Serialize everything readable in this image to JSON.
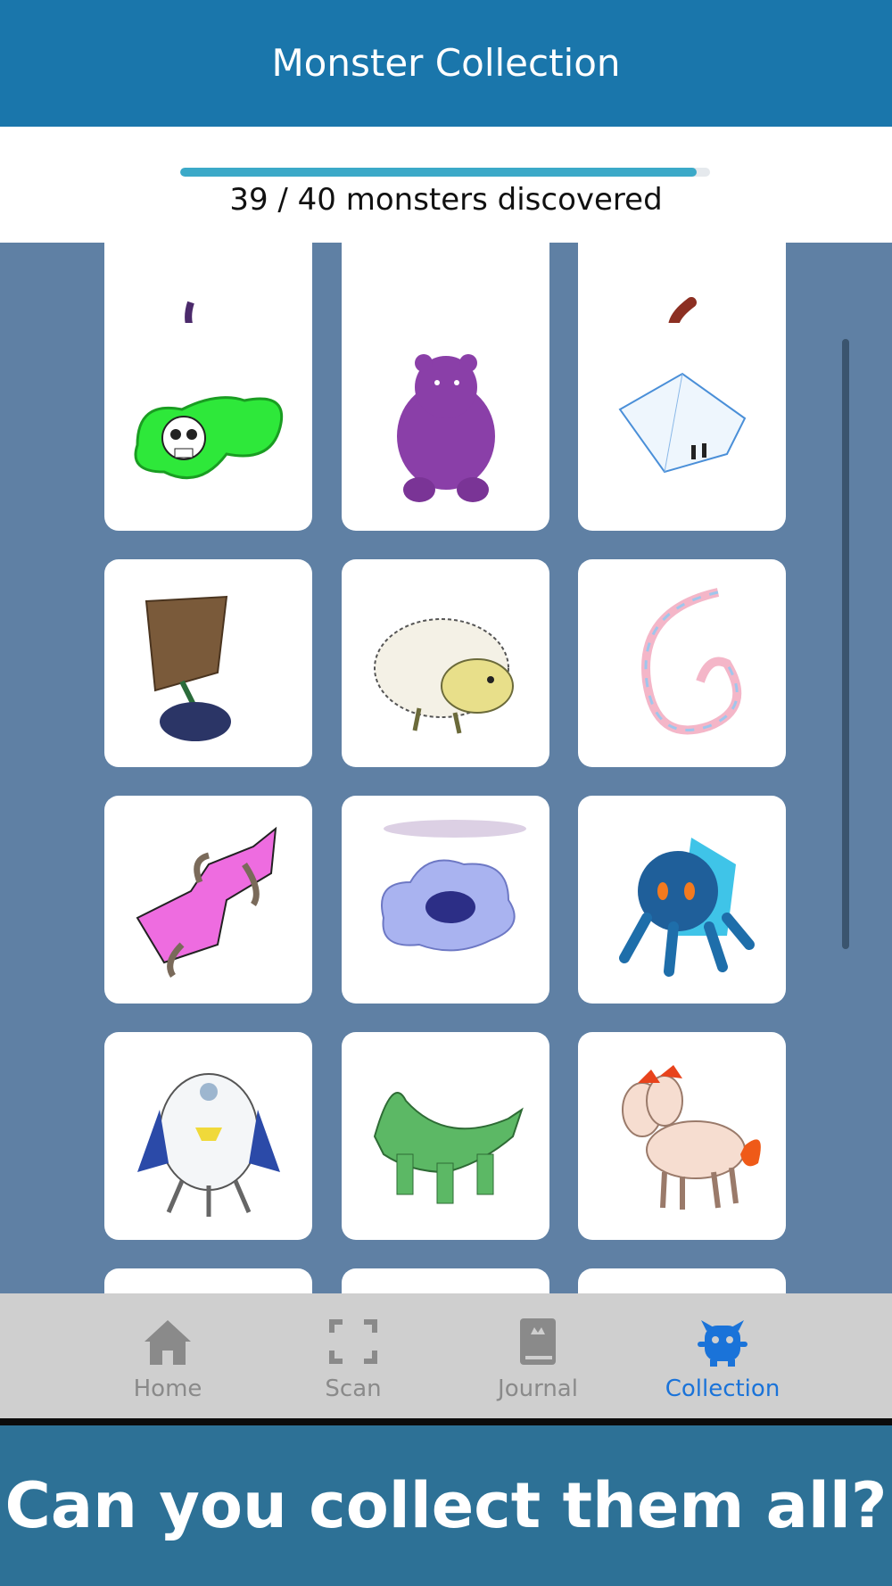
{
  "header": {
    "title": "Monster Collection"
  },
  "progress": {
    "discovered": 39,
    "total": 40,
    "label": "39 / 40 monsters discovered"
  },
  "grid": {
    "monsters": [
      "purple-tail-monster",
      "unknown-monster",
      "red-tail-monster",
      "green-skull-slime",
      "purple-bear",
      "ice-cube-creature",
      "box-shell-beetle",
      "yellow-hedgehog",
      "pastel-ribbon-snake",
      "pink-worm-creature",
      "lavender-cloud",
      "blue-crystal-spider",
      "penguin-robot",
      "green-dragon-bridge",
      "two-headed-fire-horse"
    ]
  },
  "tabs": [
    {
      "label": "Home",
      "icon": "home-icon",
      "active": false
    },
    {
      "label": "Scan",
      "icon": "scan-icon",
      "active": false
    },
    {
      "label": "Journal",
      "icon": "journal-icon",
      "active": false
    },
    {
      "label": "Collection",
      "icon": "monster-icon",
      "active": true
    }
  ],
  "colors": {
    "header": "#1a76ab",
    "accent": "#3ba9c8",
    "active_tab": "#1a73d9",
    "banner": "#2d7196"
  },
  "banner": {
    "text": "Can you collect them all?"
  }
}
